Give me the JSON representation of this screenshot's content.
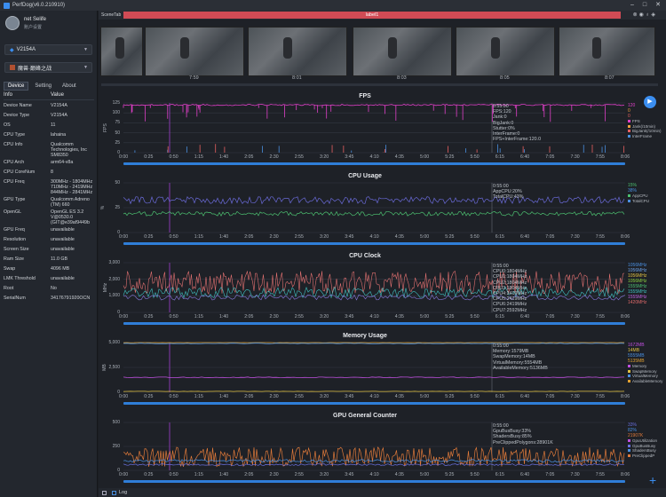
{
  "window": {
    "title": "PerfDog(v6.0.210910)"
  },
  "user": {
    "name": "net Selife",
    "sub": "账户设置"
  },
  "device_select": "V2154A",
  "app_select": "魔兽·巅峰之战",
  "tabs": [
    "Device",
    "Setting",
    "About"
  ],
  "info_header": {
    "k": "Info",
    "v": "Value"
  },
  "info_rows": [
    [
      "Device Name",
      "V2154A"
    ],
    [
      "Device Type",
      "V2154A"
    ],
    [
      "OS",
      "11"
    ],
    [
      "CPU Type",
      "lahaina"
    ],
    [
      "CPU Info",
      "Qualcomm Technologies, Inc SM8350"
    ],
    [
      "CPU Arch",
      "arm64-v8a"
    ],
    [
      "CPU CoreNum",
      "8"
    ],
    [
      "CPU Freq",
      "300MHz - 1804MHz 710MHz - 2419MHz 844MHz - 2841MHz"
    ],
    [
      "GPU Type",
      "Qualcomm Adreno (TM) 660"
    ],
    [
      "OpenGL",
      "OpenGL ES 3.2 V@0530.0 (GIT@e39af9449b"
    ],
    [
      "GPU Freq",
      "unavailable"
    ],
    [
      "Resolution",
      "unavailable"
    ],
    [
      "Screen Size",
      "unavailable"
    ],
    [
      "Ram Size",
      "11.0 GB"
    ],
    [
      "Swap",
      "4096 MB"
    ],
    [
      "LMK Threshold",
      "unavailable"
    ],
    [
      "Root",
      "No"
    ],
    [
      "SerialNum",
      "34176791920OCN"
    ]
  ],
  "scene": {
    "label": "SceneTab",
    "tag": "label1"
  },
  "thumb_times": [
    "7:59",
    "8:01",
    "8:03",
    "8:05",
    "8:07"
  ],
  "xticks": [
    "0:00",
    "0:25",
    "0:50",
    "1:15",
    "1:40",
    "2:05",
    "2:30",
    "2:55",
    "3:20",
    "3:45",
    "4:10",
    "4:35",
    "5:00",
    "5:25",
    "5:50",
    "6:15",
    "6:40",
    "7:05",
    "7:30",
    "7:55",
    "8:06"
  ],
  "status_log": "Log",
  "colors": {
    "accent": "#3b8ef0",
    "fps": "#e040c8",
    "jank": "#e86060",
    "cpu": "#4a6fd0",
    "gpu_line": "#e07a3a"
  },
  "charts": [
    {
      "id": "fps",
      "title": "FPS",
      "ylabel": "FPS",
      "yticks": [
        "125",
        "100",
        "75",
        "50",
        "25",
        "0"
      ],
      "overlay": [
        "0:55:00",
        "FPS:120",
        "Jank:0",
        "BigJank:0",
        "Stutter:0%",
        "InterFrame:0",
        "FPS+InterFrame:120.0"
      ],
      "legend_vals": [
        {
          "t": "120",
          "c": "#e040c8"
        },
        {
          "t": "0",
          "c": "#f0a040"
        },
        {
          "t": "0",
          "c": "#e86060"
        }
      ],
      "legend": [
        {
          "t": "FPS",
          "c": "#e040c8"
        },
        {
          "t": "Jank(/10min)",
          "c": "#f0a040"
        },
        {
          "t": "BigJank(/10min)",
          "c": "#e86060"
        },
        {
          "t": "InterFrame",
          "c": "#4a90e0"
        }
      ]
    },
    {
      "id": "cpu",
      "title": "CPU Usage",
      "ylabel": "%",
      "yticks": [
        "50",
        "25",
        "0"
      ],
      "overlay": [
        "0:55:00",
        "AppCPU:20%",
        "TotalCPU:43%"
      ],
      "legend_vals": [
        {
          "t": "15%",
          "c": "#4cc070"
        },
        {
          "t": "38%",
          "c": "#4a8fe0"
        }
      ],
      "legend": [
        {
          "t": "AppCPU",
          "c": "#4cc070"
        },
        {
          "t": "TotalCPU",
          "c": "#4a8fe0"
        }
      ]
    },
    {
      "id": "cpuclk",
      "title": "CPU Clock",
      "ylabel": "MHz",
      "yticks": [
        "3,000",
        "2,000",
        "1,000",
        "0"
      ],
      "overlay": [
        "0:55:00",
        "CPU0:1804MHz",
        "CPU1:1804MHz",
        "CPU2:1804MHz",
        "CPU3:1804MHz",
        "CPU4:2419MHz",
        "CPU5:2419MHz",
        "CPU6:2419MHz",
        "CPU7:2592MHz"
      ],
      "legend_vals": [
        {
          "t": "1056MHz",
          "c": "#4a8fe0"
        },
        {
          "t": "1056MHz",
          "c": "#6aa0e8"
        },
        {
          "t": "1056MHz",
          "c": "#e0c040"
        },
        {
          "t": "1056MHz",
          "c": "#8ad040"
        },
        {
          "t": "1555MHz",
          "c": "#4cc070"
        },
        {
          "t": "1555MHz",
          "c": "#40c0c0"
        },
        {
          "t": "1555MHz",
          "c": "#c060e0"
        },
        {
          "t": "1420MHz",
          "c": "#e06a6a"
        }
      ],
      "legend": []
    },
    {
      "id": "mem",
      "title": "Memory Usage",
      "ylabel": "MB",
      "yticks": [
        "5,000",
        "2,500",
        "0"
      ],
      "overlay": [
        "0:55:00",
        "Memory:1579MB",
        "SwapMemory:14MB",
        "VirtualMemory:5554MB",
        "AvailableMemory:5136MB"
      ],
      "legend_vals": [
        {
          "t": "1672MB",
          "c": "#c050e0"
        },
        {
          "t": "14MB",
          "c": "#e0c040"
        },
        {
          "t": "5555MB",
          "c": "#4a8fe0"
        },
        {
          "t": "5135MB",
          "c": "#e0a030"
        }
      ],
      "legend": [
        {
          "t": "Memory",
          "c": "#c050e0"
        },
        {
          "t": "SwapMemory",
          "c": "#e0c040"
        },
        {
          "t": "VirtualMemory",
          "c": "#4a8fe0"
        },
        {
          "t": "AvailableMemory",
          "c": "#e0a030"
        }
      ]
    },
    {
      "id": "gpu",
      "title": "GPU General Counter",
      "ylabel": "",
      "yticks": [
        "500",
        "250",
        "0"
      ],
      "overlay": [
        "0:55:00",
        "GpuBusBusy:33%",
        "ShadersBusy:85%",
        "PreClippedPolygons:28901K"
      ],
      "legend_vals": [
        {
          "t": "33%",
          "c": "#6a70e0"
        },
        {
          "t": "82%",
          "c": "#4a8fe0"
        },
        {
          "t": "21907K",
          "c": "#e07a3a"
        }
      ],
      "legend": [
        {
          "t": "GpuUtilization",
          "c": "#c050e0"
        },
        {
          "t": "GpuBusBusy",
          "c": "#6a70e0"
        },
        {
          "t": "ShadersBusy",
          "c": "#4a8fe0"
        },
        {
          "t": "PreClippedP",
          "c": "#e07a3a"
        }
      ]
    }
  ]
}
